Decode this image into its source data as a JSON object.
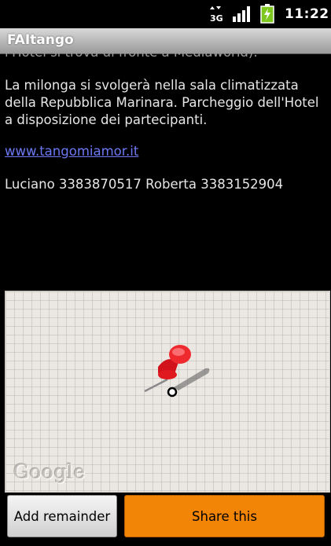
{
  "status_bar": {
    "time": "11:22",
    "network_label": "3G",
    "icons": [
      "data-arrows-icon",
      "signal-icon",
      "battery-charging-icon"
    ]
  },
  "app": {
    "title": "FAItango"
  },
  "content": {
    "cut_line": "l'Hotel si trova di fronte a Mediaworld).",
    "paragraph": "La milonga si svolgerà nella sala climatizzata della Repubblica Marinara. Parcheggio dell'Hotel a disposizione dei partecipanti.",
    "link": "www.tangomiamor.it",
    "contacts": "Luciano 3383870517  Roberta 3383152904"
  },
  "map": {
    "logo": "Google",
    "marker": "pushpin-icon"
  },
  "buttons": {
    "add_reminder": "Add remainder",
    "share": "Share this"
  },
  "colors": {
    "accent": "#f28406",
    "link": "#6c78f2",
    "title_bar": "#b5b5b5",
    "battery": "#7ec71e"
  }
}
